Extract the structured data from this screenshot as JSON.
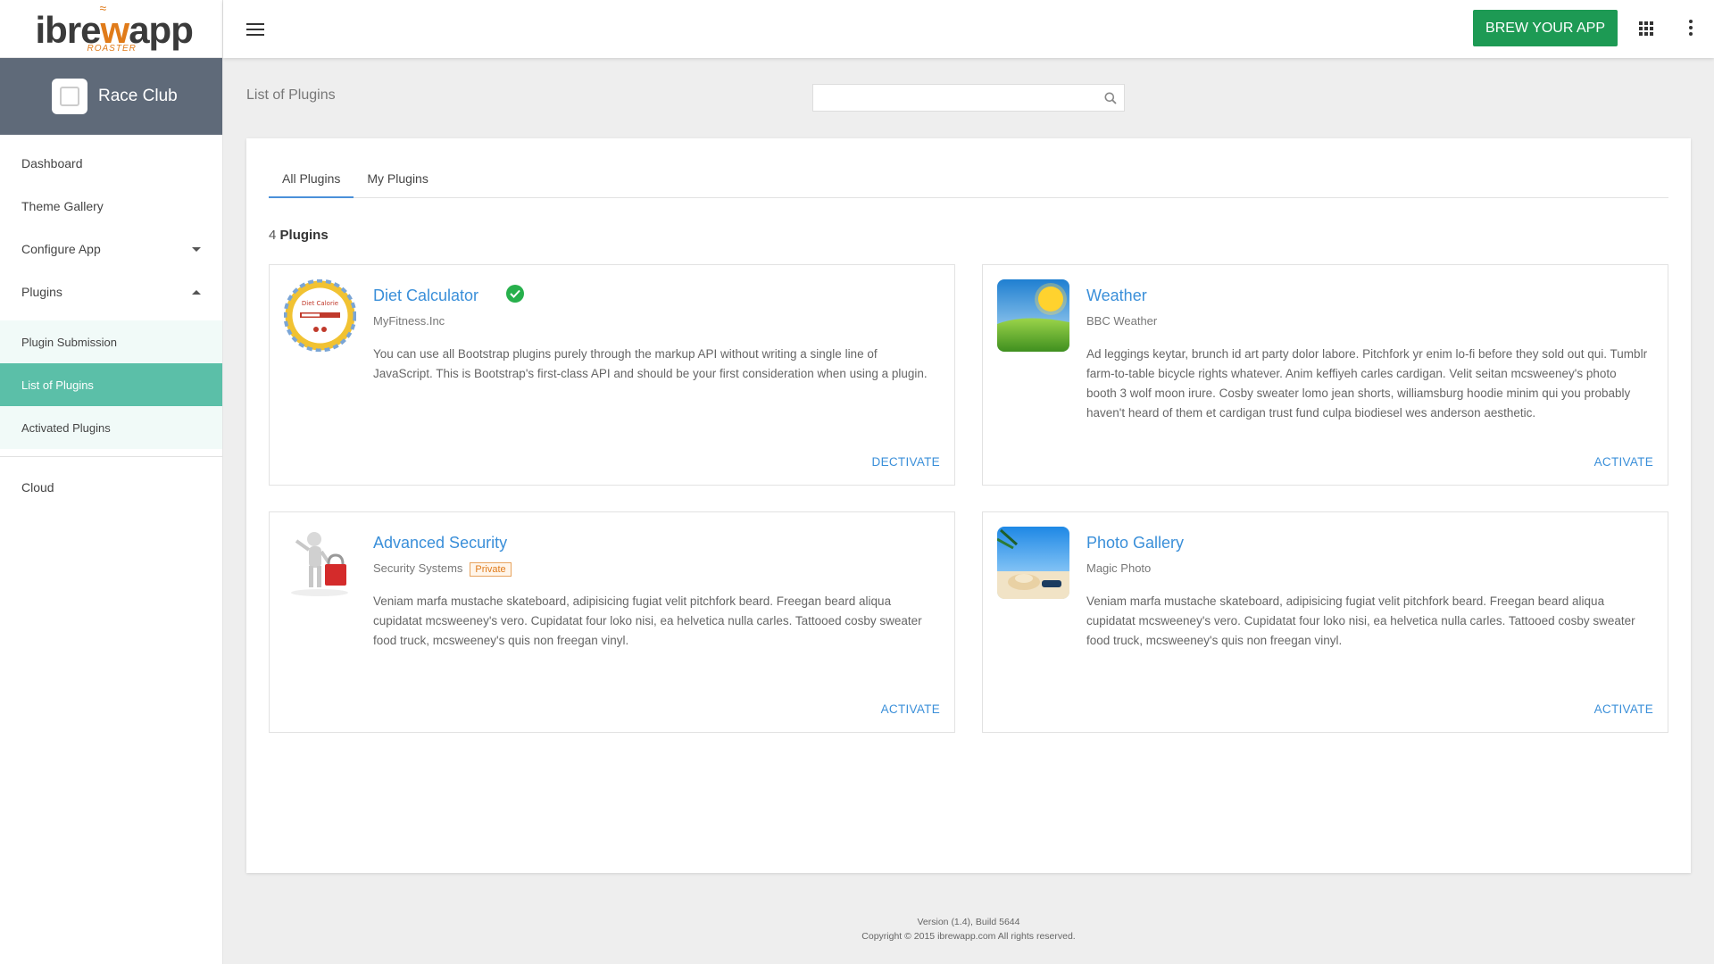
{
  "logo": {
    "main_prefix": "ibre",
    "main_accent": "w",
    "main_suffix": "app",
    "sub": "ROASTER"
  },
  "club": {
    "name": "Race Club"
  },
  "sidebar": {
    "items": [
      {
        "label": "Dashboard"
      },
      {
        "label": "Theme Gallery"
      },
      {
        "label": "Configure App"
      },
      {
        "label": "Plugins"
      }
    ],
    "plugins_sub": [
      {
        "label": "Plugin Submission"
      },
      {
        "label": "List of Plugins"
      },
      {
        "label": "Activated Plugins"
      }
    ],
    "cloud": {
      "label": "Cloud"
    }
  },
  "topbar": {
    "brew_label": "BREW YOUR APP"
  },
  "page": {
    "title": "List of Plugins",
    "search_placeholder": ""
  },
  "tabs": [
    {
      "label": "All Plugins"
    },
    {
      "label": "My Plugins"
    }
  ],
  "count": {
    "number": "4",
    "label": "Plugins"
  },
  "plugins": [
    {
      "title": "Diet Calculator",
      "vendor": "MyFitness.Inc",
      "description": "You can use all Bootstrap plugins purely through the markup API without writing a single line of JavaScript. This is Bootstrap's first-class API and should be your first consideration when using a plugin.",
      "action": "DECTIVATE",
      "verified": true,
      "thumb_text": "Diet Calorie"
    },
    {
      "title": "Weather",
      "vendor": "BBC Weather",
      "description": "Ad leggings keytar, brunch id art party dolor labore. Pitchfork yr enim lo-fi before they sold out qui. Tumblr farm-to-table bicycle rights whatever. Anim keffiyeh carles cardigan. Velit seitan mcsweeney's photo booth 3 wolf moon irure. Cosby sweater lomo jean shorts, williamsburg hoodie minim qui you probably haven't heard of them et cardigan trust fund culpa biodiesel wes anderson aesthetic.",
      "action": "ACTIVATE"
    },
    {
      "title": "Advanced Security",
      "vendor": "Security Systems",
      "badge": "Private",
      "description": "Veniam marfa mustache skateboard, adipisicing fugiat velit pitchfork beard. Freegan beard aliqua cupidatat mcsweeney's vero. Cupidatat four loko nisi, ea helvetica nulla carles. Tattooed cosby sweater food truck, mcsweeney's quis non freegan vinyl.",
      "action": "ACTIVATE"
    },
    {
      "title": "Photo Gallery",
      "vendor": "Magic Photo",
      "description": "Veniam marfa mustache skateboard, adipisicing fugiat velit pitchfork beard. Freegan beard aliqua cupidatat mcsweeney's vero. Cupidatat four loko nisi, ea helvetica nulla carles. Tattooed cosby sweater food truck, mcsweeney's quis non freegan vinyl.",
      "action": "ACTIVATE"
    }
  ],
  "footer": {
    "version": "Version (1.4), Build 5644",
    "copyright": "Copyright © 2015 ibrewapp.com All rights reserved."
  },
  "colors": {
    "accent": "#5bbfa8",
    "brew": "#1d9a54",
    "link": "#3a8fd9",
    "club_bg": "#5f6a79",
    "verified": "#27b04c"
  },
  "icons": [
    "hamburger-icon",
    "apps-grid-icon",
    "more-vert-icon",
    "search-icon",
    "check-circle-icon",
    "caret-down-icon",
    "caret-up-icon"
  ]
}
